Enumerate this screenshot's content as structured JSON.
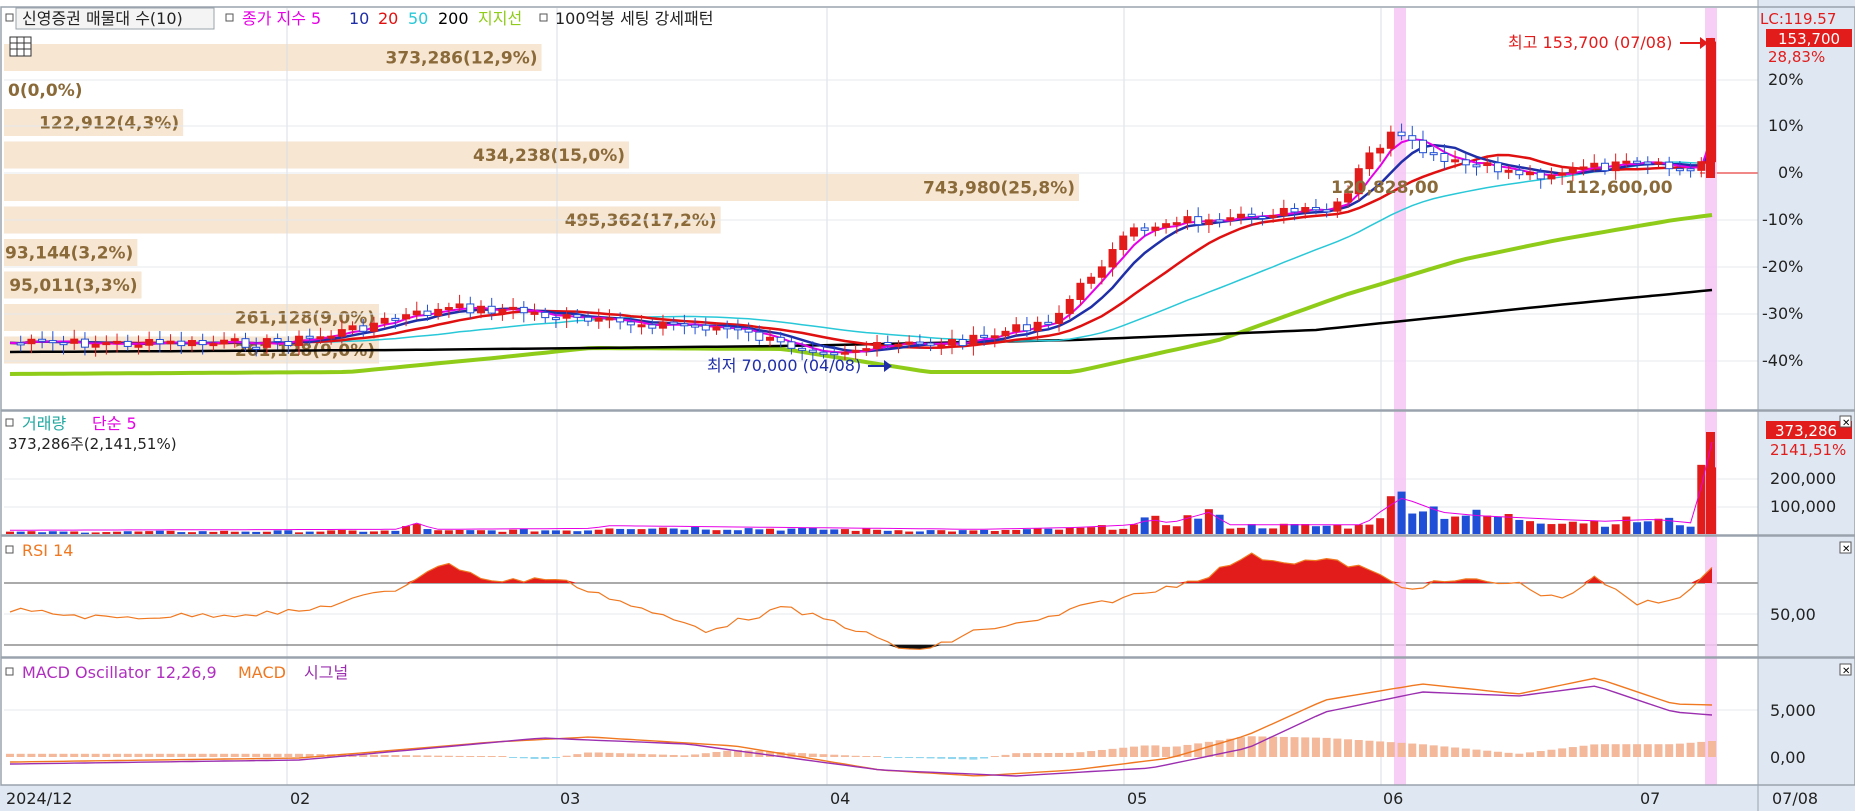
{
  "colors": {
    "up": "#e21b1b",
    "down": "#1f4fd6",
    "ma5": "#e600e6",
    "ma10": "#1f2fa8",
    "ma20": "#e01010",
    "ma50": "#28c8d8",
    "ma200": "#000000",
    "support": "#8fcc1a",
    "vp_box": "#f6e6d2",
    "vp_text": "#8b6a3a",
    "highlight": "#f5c6f5",
    "rsi": "#f07820",
    "macd": "#f07820",
    "signal": "#9b2fb0",
    "osc_pos": "#f4b89a",
    "osc_neg": "#8fd6ee",
    "axis_bg": "#dfe8f2"
  },
  "price_panel": {
    "legend": {
      "volume_profile": "신영증권 매물대 수(10)",
      "ma_title": "종가 지수 5",
      "ma10": "10",
      "ma20": "20",
      "ma50": "50",
      "ma200": "200",
      "support": "지지선",
      "pattern": "100억봉 세팅 강세패턴"
    },
    "lc_label": "LC:119.57",
    "current_price": "153,700",
    "current_pct": "28,83%",
    "high_label": "최고 153,700 (07/08)",
    "low_label": "최저 70,000 (04/08)",
    "pct_ticks": [
      "20%",
      "10%",
      "0%",
      "-10%",
      "-20%",
      "-30%",
      "-40%"
    ],
    "volume_profile": [
      {
        "label": "373,286(12,9%)",
        "share": 12.9
      },
      {
        "label": "0(0,0%)",
        "share": 0
      },
      {
        "label": "122,912(4,3%)",
        "share": 4.3
      },
      {
        "label": "434,238(15,0%)",
        "share": 15.0
      },
      {
        "label": "743,980(25,8%)",
        "share": 25.8
      },
      {
        "label": "495,362(17,2%)",
        "share": 17.2
      },
      {
        "label": "93,144(3,2%)",
        "share": 3.2
      },
      {
        "label": "95,011(3,3%)",
        "share": 3.3
      },
      {
        "label": "261,128(9,0%)",
        "share": 9.0
      },
      {
        "label": "261,128(9,0%)",
        "share": 9.0
      }
    ],
    "overlay_labels": [
      "120,828,00",
      "112,600,00"
    ]
  },
  "volume_panel": {
    "legend_title": "거래량",
    "legend_ma": "단순 5",
    "info": "373,286주(2,141,51%)",
    "current_volume": "373,286",
    "current_pct": "2141,51%",
    "ticks": [
      "200,000",
      "100,000"
    ]
  },
  "rsi_panel": {
    "legend": "RSI 14",
    "tick": "50,00"
  },
  "macd_panel": {
    "legend_osc": "MACD Oscillator 12,26,9",
    "legend_macd": "MACD",
    "legend_signal": "시그널",
    "ticks": [
      "5,000",
      "0,00"
    ]
  },
  "x_axis": {
    "labels": [
      "2024/12",
      "02",
      "03",
      "04",
      "05",
      "06",
      "07"
    ],
    "current_date": "07/08"
  },
  "icons": {
    "grid_toggle": "grid-icon",
    "legend_marker": "square-marker-icon",
    "panel_close": "close-icon",
    "high_arrow": "arrow-right-icon",
    "low_arrow": "arrow-right-icon"
  }
}
